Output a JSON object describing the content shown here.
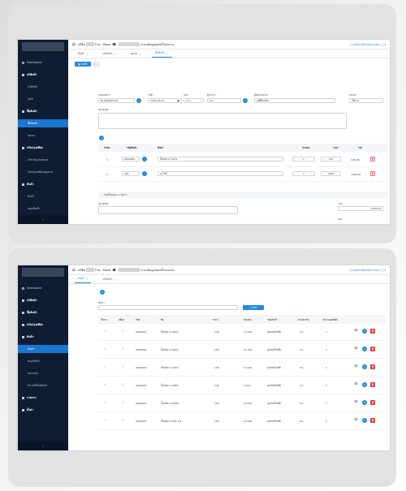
{
  "panel1": {
    "sidebar": {
      "items": [
        {
          "label": "Dashboard",
          "kind": "plain",
          "icon": "circle-icon"
        },
        {
          "label": "บริษัทค้า",
          "kind": "group",
          "icon": "box-icon"
        },
        {
          "label": "บริษัทค้า",
          "kind": "sub"
        },
        {
          "label": "ชุดสิ",
          "kind": "sub"
        },
        {
          "label": "ซื้อสินค้า",
          "kind": "group",
          "icon": "cart-icon"
        },
        {
          "label": "ซื้อสินค้า",
          "kind": "sub",
          "active": true
        },
        {
          "label": "ชุดกด",
          "kind": "sub"
        },
        {
          "label": "ปรับปรุงสต๊อก",
          "kind": "group",
          "icon": "box-icon"
        },
        {
          "label": "ปรับวัตถุเคลตเลส",
          "kind": "sub"
        },
        {
          "label": "ปรับปรุงสต๊อกสูญหาย",
          "kind": "sub"
        },
        {
          "label": "สินค้า",
          "kind": "group",
          "icon": "gear-icon"
        },
        {
          "label": "สินค้า",
          "kind": "sub"
        },
        {
          "label": "หมุดสินค้า",
          "kind": "sub"
        }
      ],
      "collapse": "‹"
    },
    "topbar": {
      "company_prefix": "บริษัท",
      "store_label": "ร้าน : Store",
      "store_suffix": "ระบบข้อมูลแยกต์โปรแกรม",
      "user": "admin@admin.com ( ) ▾"
    },
    "tabs": [
      "สินค้า",
      "บริษัทค้า",
      "ชุดกด",
      "ซื้อสินค้า"
    ],
    "toolbar": {
      "save": "บันทึก",
      "cancel": "✕"
    },
    "form": {
      "doc_label": "เลขเอกสาร :",
      "doc_value": "BL000000128",
      "date_label": "วันที่ :",
      "date_value": "2024-03-13",
      "vat_label": "VAT :",
      "vat_value": "0 %",
      "tax_label": "ผู้ว่าจ้าง :",
      "tax_value": "pur",
      "supplier_label": "ผู้จัดจำหน่าย :",
      "supplier_value": "ลุงดีดีกลอท",
      "status_label": "สถานะ :",
      "status_value": "ใช้งาน",
      "note_label": "หมายเหตุ :"
    },
    "table": {
      "headers": [
        "ลำดับ",
        "รหัสสินค้า",
        "สินค้า",
        "จำนวน",
        "ราคา",
        "รวม"
      ],
      "rows": [
        {
          "no": "1",
          "code": "A000001",
          "name": "กั้นจังหวะ เบอร์1",
          "qty": "1",
          "price": "145",
          "total": "145.00"
        },
        {
          "no": "2",
          "code": "201",
          "name": "อะไรดี",
          "qty": "1",
          "price": "1000",
          "total": "1000.00"
        }
      ],
      "summary": "รวมทั้งหมด 2 รายการ"
    },
    "footer": {
      "remark_label": "หมายเหตุ :",
      "total_label": "รวม :",
      "total_value": "1145.00",
      "vat_label": "VAT :"
    }
  },
  "panel2": {
    "sidebar": {
      "items": [
        {
          "label": "Dashboard",
          "kind": "plain",
          "icon": "circle-icon"
        },
        {
          "label": "บริษัทค้า",
          "kind": "group",
          "icon": "box-icon",
          "chev": true
        },
        {
          "label": "ซื้อสินค้า",
          "kind": "group",
          "icon": "cart-icon",
          "chev": true
        },
        {
          "label": "ปรับปรุงสต๊อก",
          "kind": "group",
          "icon": "box-icon",
          "chev": true
        },
        {
          "label": "สินค้า",
          "kind": "group",
          "icon": "gear-icon",
          "chev": true
        },
        {
          "label": "สินค้า",
          "kind": "sub",
          "active": true
        },
        {
          "label": "หมุดสินค้า",
          "kind": "sub"
        },
        {
          "label": "หน่วยนับ",
          "kind": "sub"
        },
        {
          "label": "สถานที่เก็บสินค้า",
          "kind": "sub"
        },
        {
          "label": "รายงาน",
          "kind": "group",
          "icon": "chart-icon",
          "chev": true
        },
        {
          "label": "ตั้งค่า",
          "kind": "group",
          "icon": "gear-icon",
          "chev": true
        }
      ],
      "collapse": "‹"
    },
    "topbar": {
      "company_prefix": "บริษัท",
      "store_label": "ร้าน : Store",
      "store_suffix": "ระบบข้อมูลแยกต์โปรแกรม",
      "user": "admin@admin.com ( ) ▾"
    },
    "tabs": [
      "สินค้า",
      "บริษัทค้า"
    ],
    "search": {
      "label": "ค้นหา :",
      "button": "ค้นหา"
    },
    "table": {
      "headers": [
        "ใช้งาน",
        "สต็อค",
        "รหัส",
        "ชื่อ",
        "ราคา",
        "คงเหลือ",
        "กลุ่มสินค้า",
        "ขนาดบรรจุ",
        "จำนวนจุดสต๊อก"
      ],
      "rows": [
        {
          "active": "✓",
          "stock": "✓",
          "code": "A000001",
          "name": "กั้นจังหวะ เบอร์1",
          "price": "145",
          "remain": "1.5 ดน.",
          "group": "อุปกรณ์ไฟฟ้า",
          "size": "0.1",
          "point": "1"
        },
        {
          "active": "✓",
          "stock": "✓",
          "code": "A000002",
          "name": "กั้นจังหวะ เบอร์2",
          "price": "145",
          "remain": "0.1 ดน.",
          "group": "อุปกรณ์ไฟฟ้า",
          "size": "0.1",
          "point": "1"
        },
        {
          "active": "✓",
          "stock": "✓",
          "code": "A000003",
          "name": "กั้นจังหวะ เบอร์3",
          "price": "145",
          "remain": "0.2 ดน.",
          "group": "อุปกรณ์ไฟฟ้า",
          "size": "0.1",
          "point": "1"
        },
        {
          "active": "✓",
          "stock": "✓",
          "code": "A000005",
          "name": "กั้นจังหวะ เบอร์5",
          "price": "145",
          "remain": "-5 ดน.",
          "group": "อุปกรณ์ไฟฟ้า",
          "size": "0.1",
          "point": "1"
        },
        {
          "active": "✓",
          "stock": "✓",
          "code": "A000007",
          "name": "กั้นจังหวะ เบอร์8",
          "price": "145",
          "remain": "0.6 ดน.",
          "group": "อุปกรณ์ไฟฟ้า",
          "size": "0.1",
          "point": "1"
        },
        {
          "active": "✓",
          "stock": "✓",
          "code": "A000003",
          "name": "กั้นจังหวะ เบอร์ 1/2",
          "price": "145",
          "remain": "0.3 ดน.",
          "group": "อุปกรณ์ไฟฟ้า",
          "size": "0.1",
          "point": "1"
        }
      ]
    }
  }
}
